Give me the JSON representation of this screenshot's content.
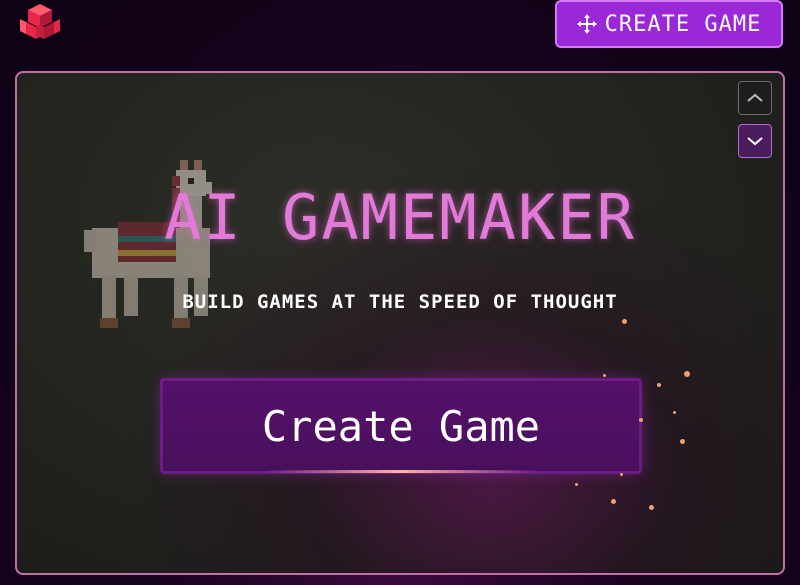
{
  "header": {
    "create_button_label": "CREATE GAME",
    "logo_icon": "stacked-cubes-logo",
    "create_button_icon": "move-arrows-icon"
  },
  "hero": {
    "title": "AI GAMEMAKER",
    "subtitle": "BUILD GAMES AT THE SPEED OF THOUGHT",
    "create_button_label": "Create Game",
    "up_icon": "chevron-up-icon",
    "down_icon": "chevron-down-icon"
  },
  "colors": {
    "accent": "#9b28d6",
    "title": "#e27bd8",
    "panel_border": "#c46ea8",
    "logo": "#e8264a"
  }
}
